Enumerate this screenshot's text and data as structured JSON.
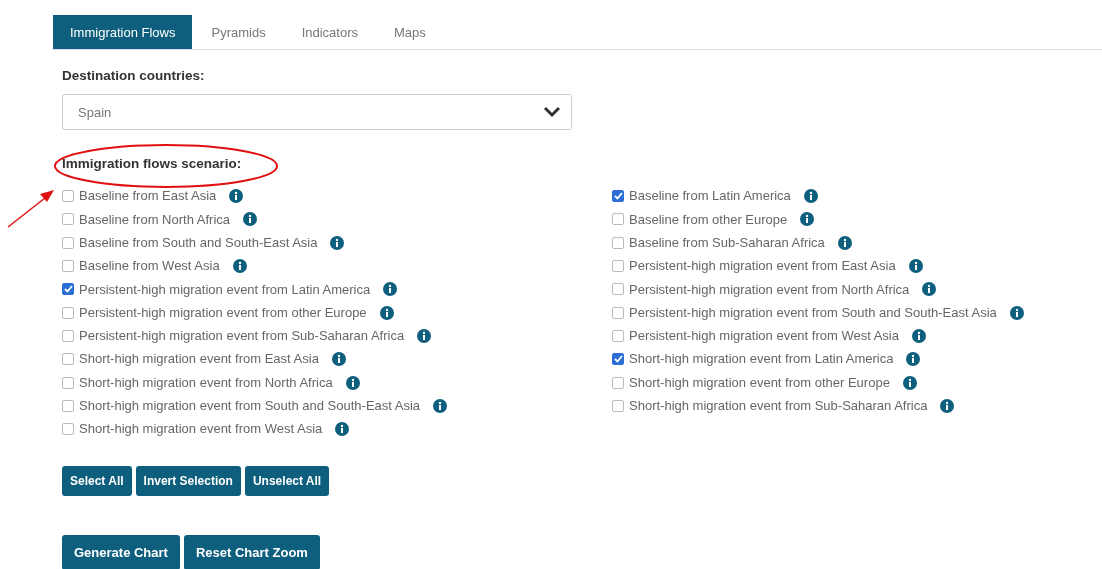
{
  "tabs": [
    {
      "label": "Immigration Flows",
      "selected": true
    },
    {
      "label": "Pyramids",
      "selected": false
    },
    {
      "label": "Indicators",
      "selected": false
    },
    {
      "label": "Maps",
      "selected": false
    }
  ],
  "destination": {
    "label": "Destination countries:",
    "value": "Spain"
  },
  "scenario": {
    "label": "Immigration flows scenario:",
    "columns": [
      [
        {
          "label": "Baseline from East Asia",
          "checked": false
        },
        {
          "label": "Baseline from North Africa",
          "checked": false
        },
        {
          "label": "Baseline from South and South-East Asia",
          "checked": false
        },
        {
          "label": "Baseline from West Asia",
          "checked": false
        },
        {
          "label": "Persistent-high migration event from Latin America",
          "checked": true
        },
        {
          "label": "Persistent-high migration event from other Europe",
          "checked": false
        },
        {
          "label": "Persistent-high migration event from Sub-Saharan Africa",
          "checked": false
        },
        {
          "label": "Short-high migration event from East Asia",
          "checked": false
        },
        {
          "label": "Short-high migration event from North Africa",
          "checked": false
        },
        {
          "label": "Short-high migration event from South and South-East Asia",
          "checked": false
        },
        {
          "label": "Short-high migration event from West Asia",
          "checked": false
        }
      ],
      [
        {
          "label": "Baseline from Latin America",
          "checked": true
        },
        {
          "label": "Baseline from other Europe",
          "checked": false
        },
        {
          "label": "Baseline from Sub-Saharan Africa",
          "checked": false
        },
        {
          "label": "Persistent-high migration event from East Asia",
          "checked": false
        },
        {
          "label": "Persistent-high migration event from North Africa",
          "checked": false
        },
        {
          "label": "Persistent-high migration event from South and South-East Asia",
          "checked": false
        },
        {
          "label": "Persistent-high migration event from West Asia",
          "checked": false
        },
        {
          "label": "Short-high migration event from Latin America",
          "checked": true
        },
        {
          "label": "Short-high migration event from other Europe",
          "checked": false
        },
        {
          "label": "Short-high migration event from Sub-Saharan Africa",
          "checked": false
        }
      ]
    ]
  },
  "selection_buttons": [
    "Select All",
    "Invert Selection",
    "Unselect All"
  ],
  "chart_buttons": [
    "Generate Chart",
    "Reset Chart Zoom"
  ]
}
